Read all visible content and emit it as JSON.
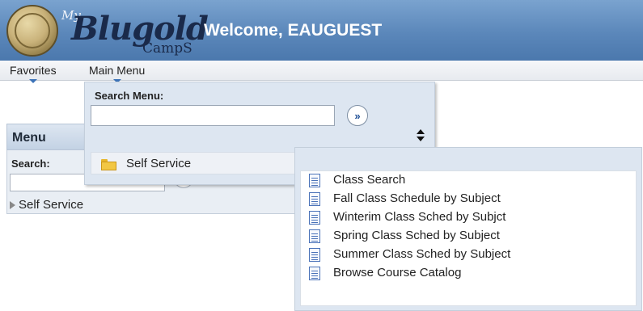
{
  "header": {
    "logo": {
      "my": "My",
      "blugold": "Blugold",
      "camps": "CampS"
    },
    "welcome": "Welcome, EAUGUEST"
  },
  "nav": {
    "items": [
      {
        "label": "Favorites"
      },
      {
        "label": "Main Menu"
      }
    ]
  },
  "menu_panel": {
    "title": "Menu",
    "search_label": "Search:",
    "search_value": "",
    "tree_item": "Self Service"
  },
  "main_menu_dropdown": {
    "search_label": "Search Menu:",
    "search_value": "",
    "go_glyph": "»",
    "folder_item": "Self Service"
  },
  "self_service_submenu": {
    "items": [
      {
        "label": "Class Search"
      },
      {
        "label": "Fall Class Schedule by Subject"
      },
      {
        "label": "Winterim Class Sched by Subjct"
      },
      {
        "label": "Spring Class Sched by Subject"
      },
      {
        "label": "Summer Class Sched by Subject"
      },
      {
        "label": "Browse Course Catalog"
      }
    ]
  },
  "colors": {
    "header_blue": "#5b87ba",
    "menu_panel_bg": "#dde6f1",
    "accent_arrow": "#3c73b8",
    "folder_yellow": "#f2c744"
  }
}
